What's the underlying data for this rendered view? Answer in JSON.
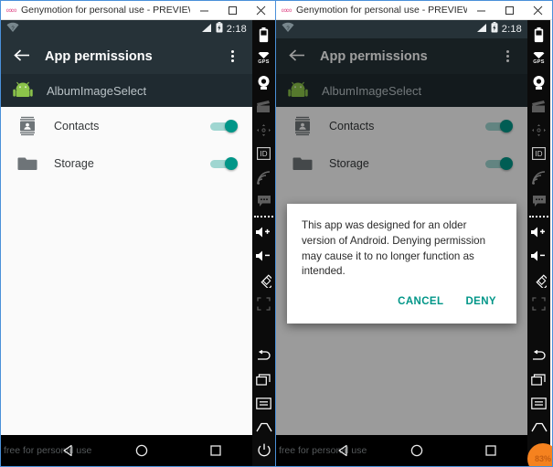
{
  "window": {
    "title": "Genymotion for personal use - PREVIEW - Google N...",
    "icon": "genymotion-logo-icon",
    "minimize_label": "–",
    "maximize_label": "□",
    "close_label": "✕",
    "accent_border": "#4a90d9"
  },
  "device": {
    "status_bar": {
      "wifi_icon": "wifi-no-internet-icon",
      "signal_icon": "cell-signal-icon",
      "battery_icon": "battery-icon",
      "time": "2:18"
    },
    "action_bar": {
      "back_icon": "arrow-back-icon",
      "title": "App permissions",
      "overflow_icon": "more-vertical-icon"
    },
    "app_header": {
      "app_icon": "android-robot-icon",
      "app_name": "AlbumImageSelect"
    },
    "permissions": [
      {
        "icon": "contacts-icon",
        "label": "Contacts",
        "enabled": true
      },
      {
        "icon": "folder-icon",
        "label": "Storage",
        "enabled": true
      }
    ],
    "nav_bar": {
      "watermark": "free for personal use",
      "back_icon": "nav-back-triangle-icon",
      "home_icon": "nav-home-circle-icon",
      "recents_icon": "nav-recents-square-icon",
      "power_icon": "nav-power-icon"
    },
    "colors": {
      "action_bar": "#263238",
      "app_header": "#1f2a30",
      "switch_on": "#009688",
      "list_bg": "#fafafa"
    }
  },
  "dialog": {
    "message": "This app was designed for an older version of Android. Denying permission may cause it to no longer function as intended.",
    "cancel_label": "CANCEL",
    "deny_label": "DENY",
    "accent": "#009688"
  },
  "toolbar": {
    "items": [
      {
        "name": "battery-tool-icon",
        "label": ""
      },
      {
        "name": "gps-tool-icon",
        "label": "GPS"
      },
      {
        "name": "camera-tool-icon",
        "label": ""
      },
      {
        "name": "video-recorder-tool-icon",
        "label": ""
      },
      {
        "name": "accelerometer-tool-icon",
        "label": ""
      },
      {
        "name": "identifiers-tool-icon",
        "label": "ID"
      },
      {
        "name": "network-tool-icon",
        "label": ""
      },
      {
        "name": "phone-sms-tool-icon",
        "label": ""
      },
      {
        "name": "volume-up-tool-icon",
        "label": ""
      },
      {
        "name": "volume-down-tool-icon",
        "label": ""
      },
      {
        "name": "rotate-tool-icon",
        "label": ""
      },
      {
        "name": "fullscreen-tool-icon",
        "label": ""
      },
      {
        "name": "back-tool-icon",
        "label": ""
      },
      {
        "name": "recents-tool-icon",
        "label": ""
      },
      {
        "name": "menu-tool-icon",
        "label": ""
      },
      {
        "name": "home-tool-icon",
        "label": ""
      },
      {
        "name": "power-tool-icon",
        "label": ""
      }
    ]
  },
  "badge": {
    "text": "83%",
    "color": "#f5821f"
  }
}
